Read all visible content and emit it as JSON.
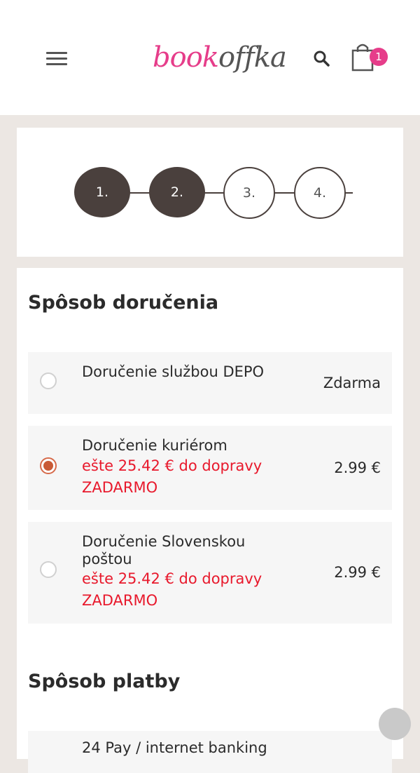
{
  "header": {
    "logo_part1": "book",
    "logo_part2": "offka",
    "cart_count": "1",
    "colors": {
      "brand_pink": "#e63d8a",
      "dark": "#4a403d"
    }
  },
  "steps": [
    {
      "label": "1.",
      "state": "done"
    },
    {
      "label": "2.",
      "state": "done"
    },
    {
      "label": "3.",
      "state": "todo"
    },
    {
      "label": "4.",
      "state": "todo"
    }
  ],
  "delivery": {
    "title": "Spôsob doručenia",
    "options": [
      {
        "name": "Doručenie službou DEPO",
        "price": "Zdarma",
        "selected": false
      },
      {
        "name": "Doručenie kuriérom",
        "note": "ešte 25.42 € do dopravy ZADARMO",
        "price": "2.99 €",
        "selected": true
      },
      {
        "name": "Doručenie Slovenskou poštou",
        "note": "ešte 25.42 € do dopravy ZADARMO",
        "price": "2.99 €",
        "selected": false
      }
    ]
  },
  "payment": {
    "title": "Spôsob platby",
    "first_option": "24 Pay / internet banking"
  },
  "icons": [
    "menu-icon",
    "search-icon",
    "cart-icon",
    "radio-icon"
  ]
}
